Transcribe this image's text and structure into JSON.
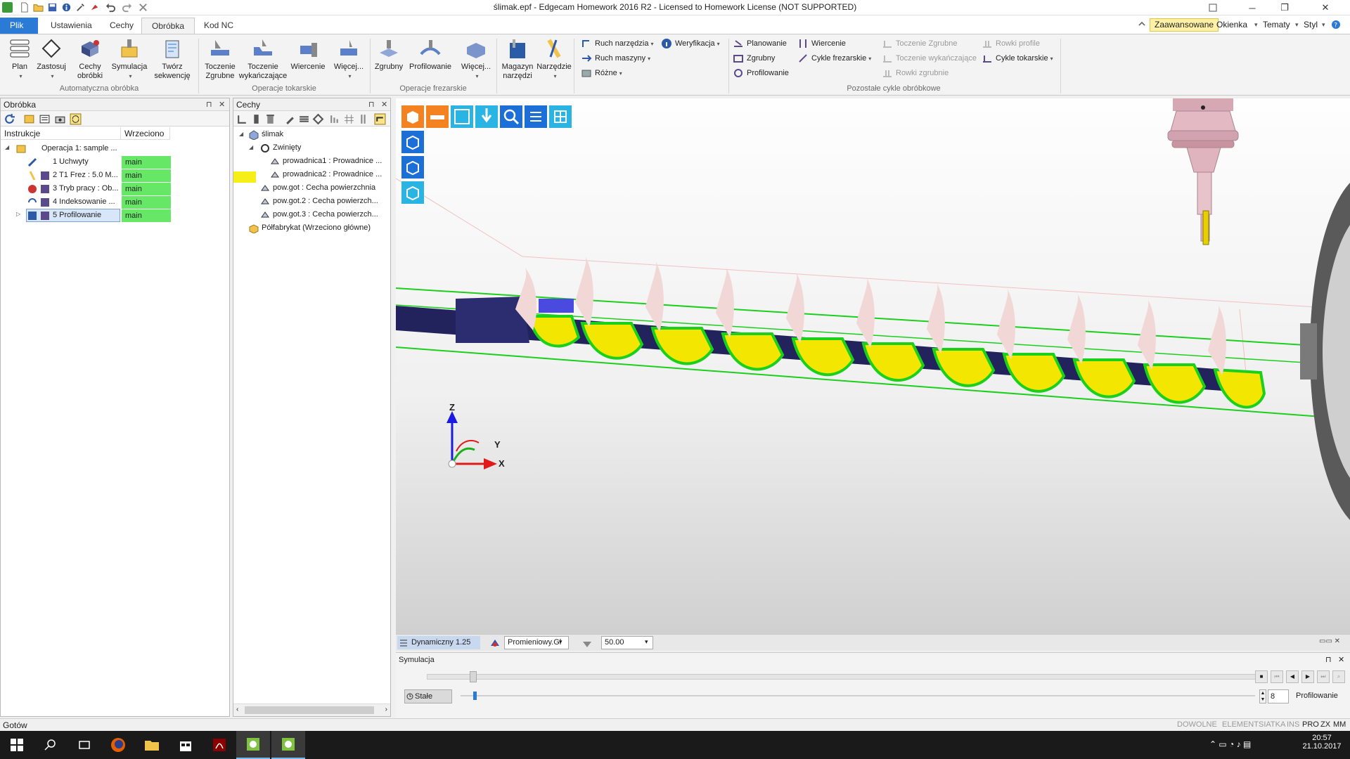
{
  "title": "ślimak.epf - Edgecam Homework 2016 R2  -  Licensed to Homework License (NOT SUPPORTED)",
  "tabs": [
    "Plik",
    "Ustawienia",
    "Cechy",
    "Obróbka",
    "Kod NC"
  ],
  "active_tab": "Obróbka",
  "right_tabs": {
    "advanced": "Zaawansowane",
    "windows": "Okienka",
    "themes": "Tematy",
    "style": "Styl"
  },
  "ribbon": {
    "auto": {
      "b1": "Plan",
      "b2": "Zastosuj",
      "b3a": "Cechy",
      "b3b": "obróbki",
      "b4": "Symulacja",
      "b5a": "Twórz",
      "b5b": "sekwencję",
      "label": "Automatyczna obróbka"
    },
    "turn": {
      "b1a": "Toczenie",
      "b1b": "Zgrubne",
      "b2a": "Toczenie",
      "b2b": "wykańczające",
      "b3": "Wiercenie",
      "b4": "Więcej...",
      "label": "Operacje tokarskie"
    },
    "mill": {
      "b1": "Zgrubny",
      "b2": "Profilowanie",
      "b3": "Więcej...",
      "label": "Operacje frezarskie"
    },
    "tools": {
      "b1a": "Magazyn",
      "b1b": "narzędzi",
      "b2": "Narzędzie"
    },
    "motion": {
      "s1": "Ruch narzędzia",
      "s2": "Ruch maszyny",
      "s3": "Różne",
      "s4": "Weryfikacja"
    },
    "other": {
      "c1": "Planowanie",
      "c2": "Zgrubny",
      "c3": "Profilowanie",
      "c4": "Wiercenie",
      "c5": "Cykle frezarskie",
      "d1": "Toczenie Zgrubne",
      "d2": "Toczenie wykańczające",
      "d3": "Rowki zgrubnie",
      "d4": "Rowki profile",
      "d5": "Cykle tokarskie",
      "label": "Pozostałe cykle obróbkowe"
    }
  },
  "obrobka": {
    "title": "Obróbka",
    "col1": "Instrukcje",
    "col2": "Wrzeciono",
    "operation": "Operacja 1: sample ...",
    "rows": [
      {
        "label": "1 Uchwyty",
        "spindle": "main"
      },
      {
        "label": "2 T1 Frez : 5.0 M...",
        "spindle": "main"
      },
      {
        "label": "3 Tryb pracy : Ob...",
        "spindle": "main"
      },
      {
        "label": "4 Indeksowanie ...",
        "spindle": "main"
      },
      {
        "label": "5 Profilowanie",
        "spindle": "main"
      }
    ]
  },
  "cechy": {
    "title": "Cechy",
    "root": "ślimak",
    "group": "Zwinięty",
    "items": [
      "prowadnica1 :  Prowadnice ...",
      "prowadnica2 :  Prowadnice ...",
      "pow.got :  Cecha powierzchnia",
      "pow.got.2 :  Cecha powierzch...",
      "pow.got.3 :  Cecha powierzch..."
    ],
    "stock": "Półfabrykat (Wrzeciono główne)"
  },
  "viewport": {
    "axis_x": "X",
    "axis_y": "Y",
    "axis_z": "Z"
  },
  "viewbar": {
    "mode": "Dynamiczny 1.25",
    "shading": "Promieniowy.Gł",
    "value": "50.00"
  },
  "simulation": {
    "title": "Symulacja",
    "stale": "Stałe",
    "steps": "8",
    "op": "Profilowanie"
  },
  "status": {
    "left": "Gotów",
    "dowolne": "DOWOLNE",
    "element": "ELEMENT",
    "siatka": "SIATKA",
    "ins": "INS",
    "pro": "PRO",
    "zx": "ZX",
    "mm": "MM"
  },
  "clock": {
    "time": "20:57",
    "date": "21.10.2017"
  },
  "colors": {
    "accent": "#2b7bd6",
    "spindle": "#66e866",
    "part": "#2a2a66",
    "chip": "#f3e600"
  }
}
